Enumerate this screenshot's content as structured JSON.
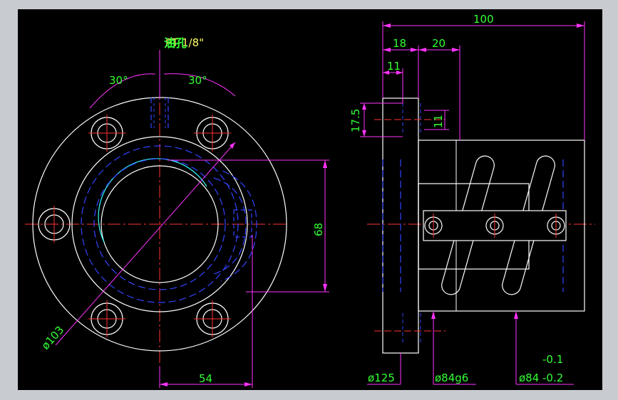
{
  "drawing": {
    "background": "#000000",
    "colors": {
      "outline": "#ffffff",
      "dimension": "#ff33ff",
      "centerline": "#ff3333",
      "hidden": "#3333ff",
      "text": "#33ff33",
      "cyan": "#33ffff",
      "yellow": "#ffff66"
    },
    "front_view": {
      "oil_hole_label": "油孔",
      "pt_label": "PT 1/8\"",
      "angle_left": "30°",
      "angle_right": "30°",
      "pcd_dim": "ø103",
      "height_dim": "68",
      "width_dim": "54"
    },
    "side_view": {
      "total_length": "100",
      "dim_18": "18",
      "dim_20": "20",
      "dim_11_top": "11",
      "dim_17_5": "17.5",
      "dim_11_side": "11",
      "dia_125": "ø125",
      "dia_84g6": "ø84g6",
      "dia_84": "ø84",
      "tolerance_upper": "-0.1",
      "tolerance_lower": "-0.2"
    }
  }
}
